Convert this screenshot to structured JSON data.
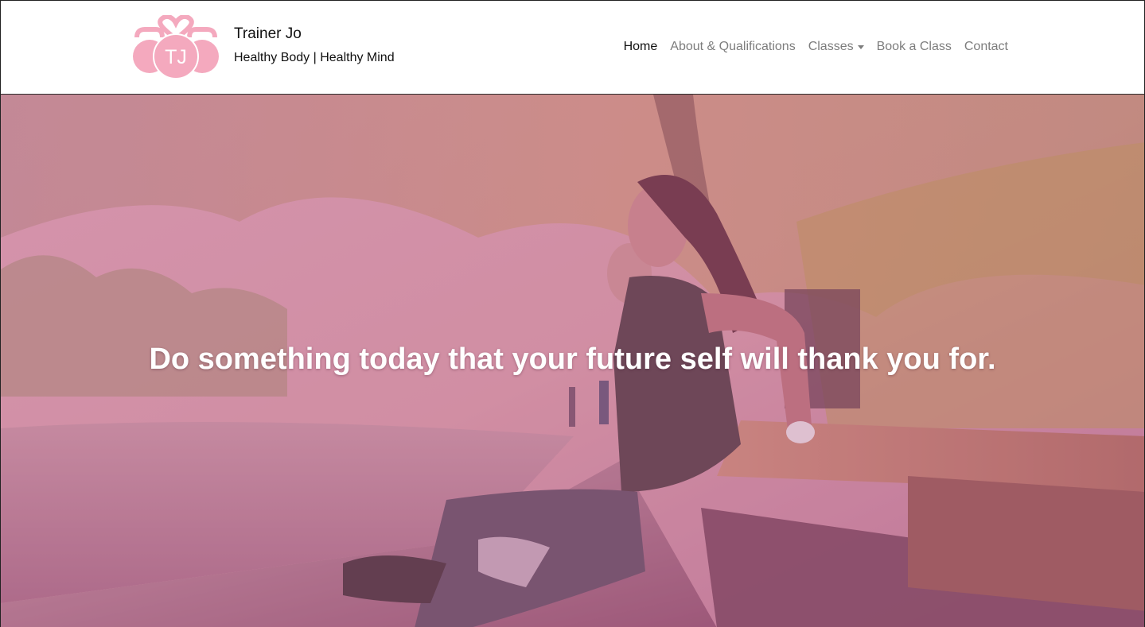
{
  "brand": {
    "logo_initials": "TJ",
    "title": "Trainer Jo",
    "tagline": "Healthy Body | Healthy Mind"
  },
  "nav": {
    "items": [
      {
        "label": "Home",
        "active": true
      },
      {
        "label": "About & Qualifications",
        "active": false
      },
      {
        "label": "Classes",
        "active": false,
        "dropdown": true
      },
      {
        "label": "Book a Class",
        "active": false
      },
      {
        "label": "Contact",
        "active": false
      }
    ]
  },
  "hero": {
    "quote": "Do something today that your future self will thank you for."
  },
  "colors": {
    "logo_pink": "#f4a9be",
    "overlay": "#c86e96",
    "nav_active": "#111111",
    "nav_inactive": "#7d7d7d"
  }
}
